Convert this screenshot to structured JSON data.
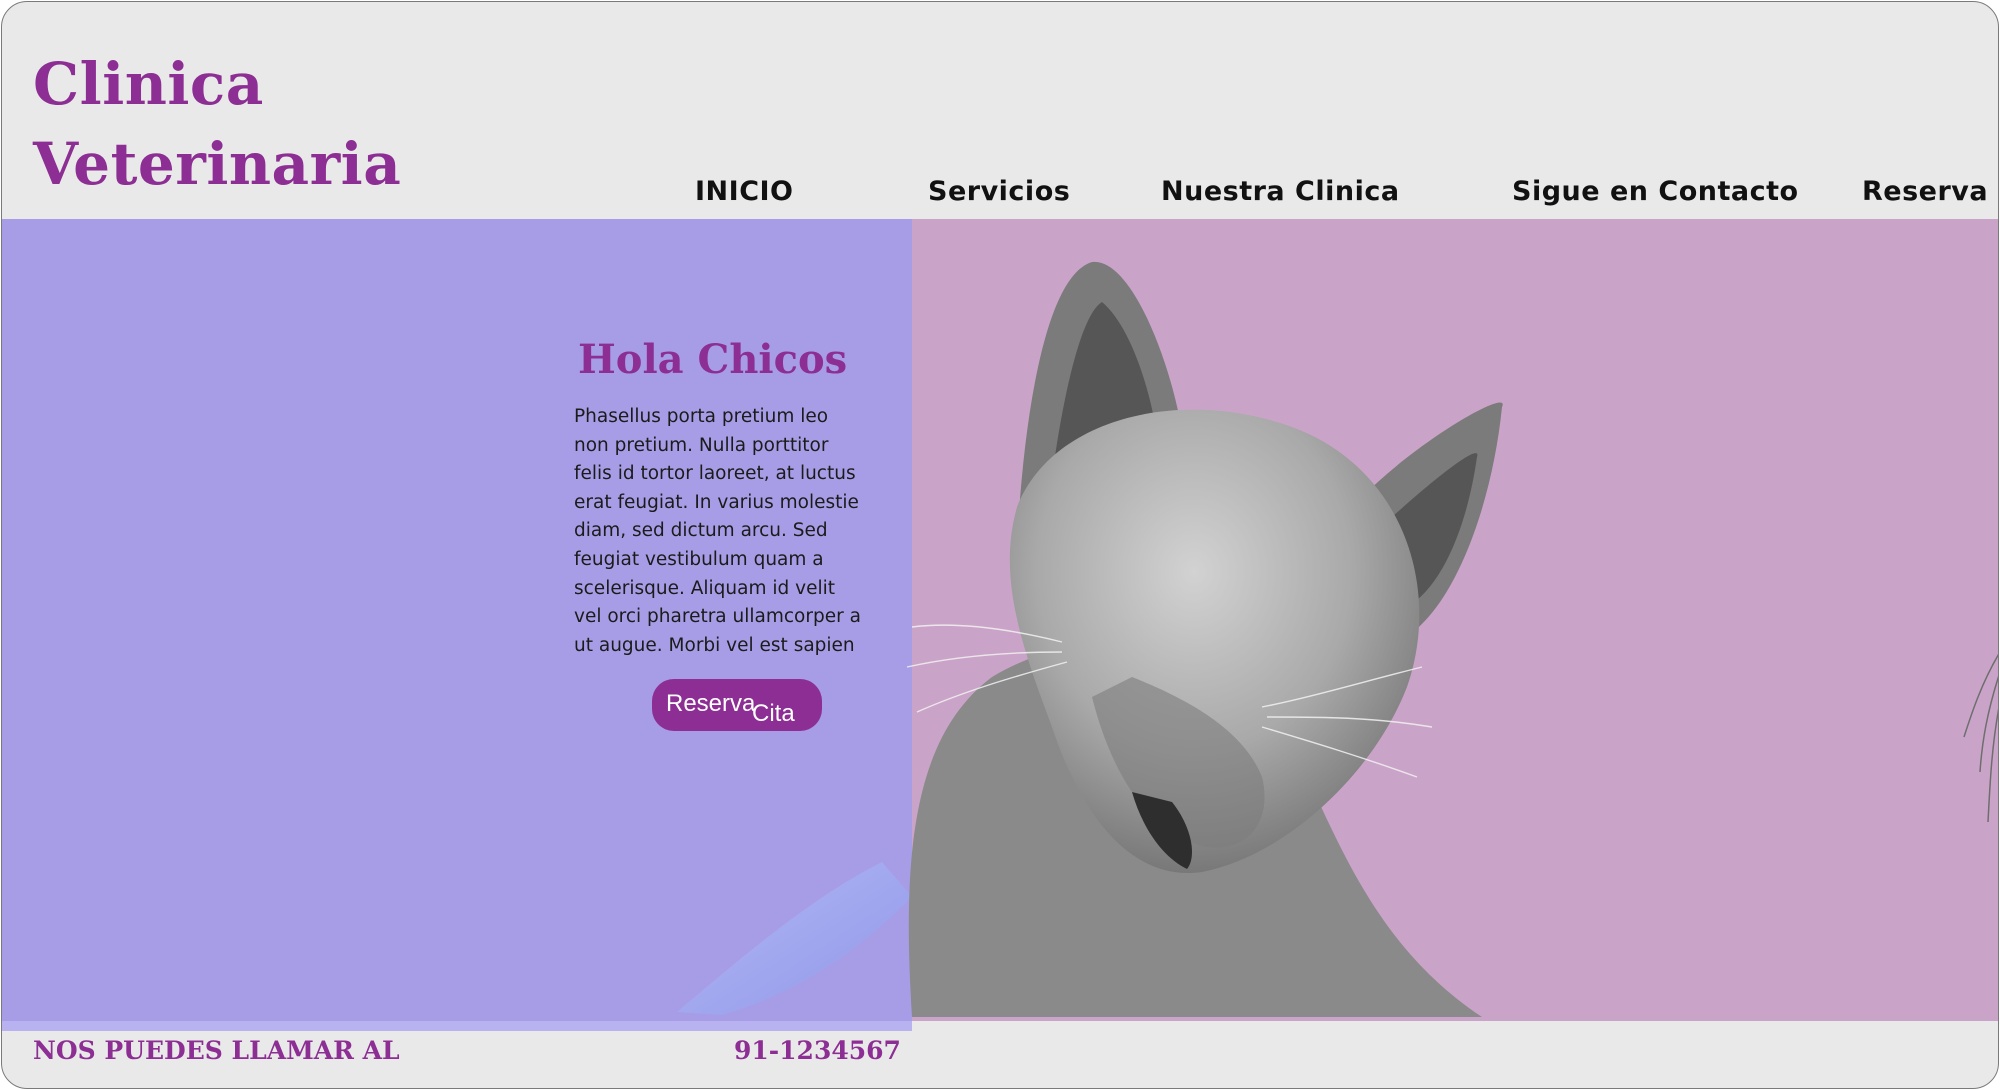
{
  "header": {
    "logo_line1": "Clinica",
    "logo_line2": "Veterinaria"
  },
  "nav": {
    "items": [
      {
        "label": "INICIO"
      },
      {
        "label": "Servicios"
      },
      {
        "label": "Nuestra Clinica"
      },
      {
        "label": "Sigue en Contacto"
      },
      {
        "label": "Reserva"
      }
    ]
  },
  "hero": {
    "title": "Hola Chicos",
    "body": "Phasellus porta pretium leo non pretium. Nulla porttitor felis id tortor laoreet, at luctus erat feugiat. In varius molestie diam, sed dictum arcu. Sed feugiat vestibulum quam a scelerisque. Aliquam id velit vel orci pharetra ullamcorper a ut augue. Morbi vel est sapien",
    "cta_word1": "Reserva",
    "cta_word2": "Cita"
  },
  "footer": {
    "call_text": "NOS PUEDES LLAMAR AL",
    "phone": "91-1234567"
  },
  "colors": {
    "brand_purple": "#8c2e93",
    "hero_left_bg": "#a79de6",
    "hero_right_bg": "#caa4c8",
    "page_bg": "#eae9ea"
  },
  "icons": {
    "hero_image": "cat-photo"
  }
}
